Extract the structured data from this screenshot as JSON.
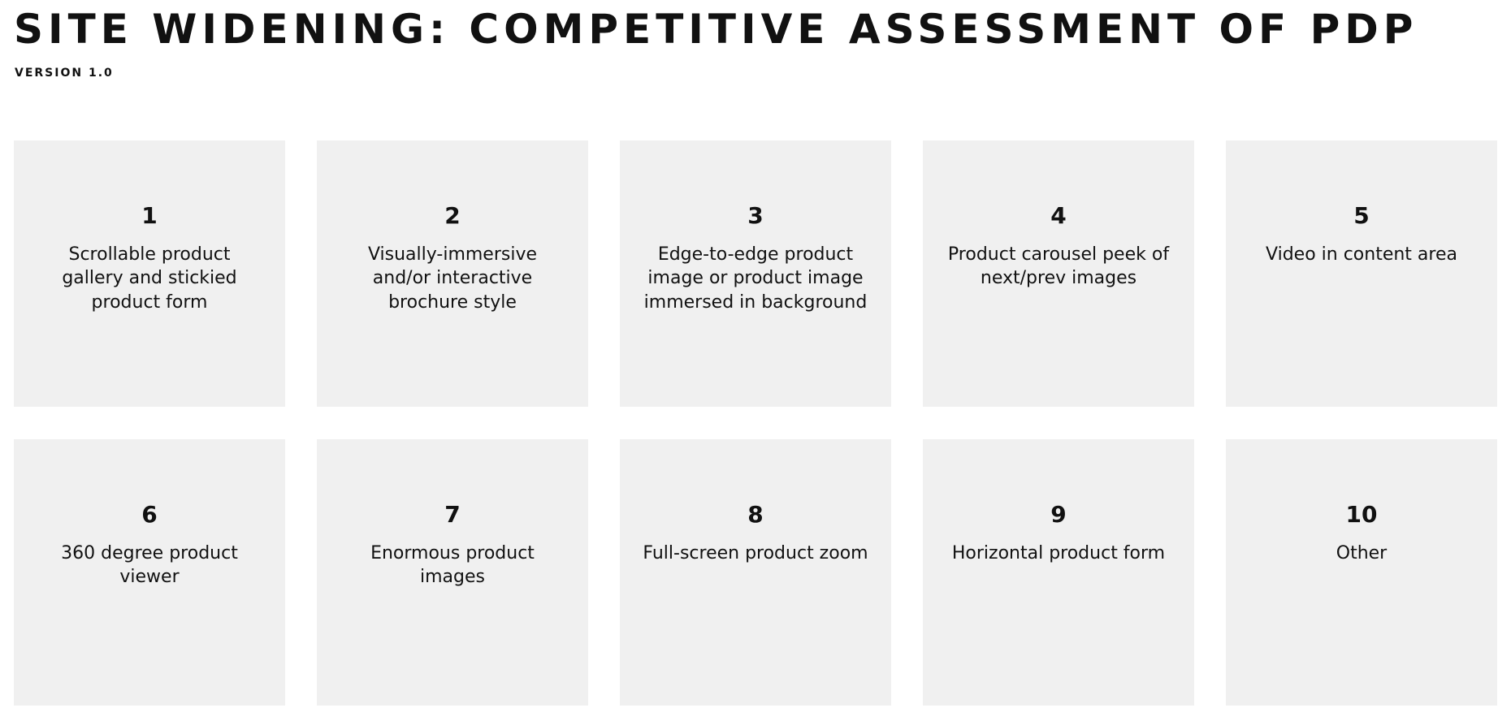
{
  "header": {
    "title": "SITE WIDENING: COMPETITIVE ASSESSMENT OF PDP",
    "version": "VERSION 1.0"
  },
  "cards": [
    {
      "number": "1",
      "label": "Scrollable product gallery and stickied product form"
    },
    {
      "number": "2",
      "label": "Visually-immersive and/or interactive brochure style"
    },
    {
      "number": "3",
      "label": "Edge-to-edge product image or product image immersed in background"
    },
    {
      "number": "4",
      "label": "Product carousel peek of next/prev images"
    },
    {
      "number": "5",
      "label": "Video in content area"
    },
    {
      "number": "6",
      "label": "360 degree product viewer"
    },
    {
      "number": "7",
      "label": "Enormous product images"
    },
    {
      "number": "8",
      "label": "Full-screen product zoom"
    },
    {
      "number": "9",
      "label": "Horizontal product form"
    },
    {
      "number": "10",
      "label": "Other"
    }
  ],
  "colors": {
    "card_background": "#f0f0f0",
    "text": "#111111",
    "page_background": "#ffffff"
  }
}
